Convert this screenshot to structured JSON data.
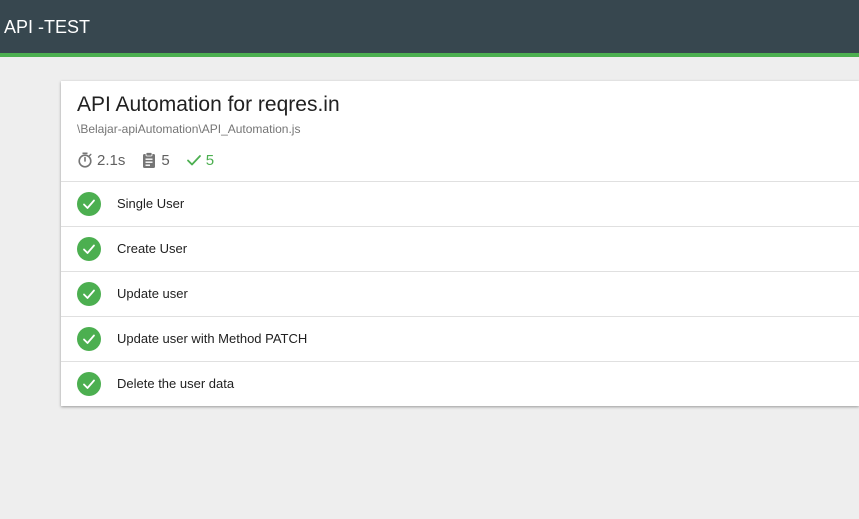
{
  "header": {
    "title": "API -TEST"
  },
  "suite": {
    "title": "API Automation for reqres.in",
    "file": "\\Belajar-apiAutomation\\API_Automation.js",
    "stats": {
      "duration": "2.1s",
      "tests": "5",
      "passed": "5"
    }
  },
  "tests": [
    {
      "title": "Single User",
      "status": "passed"
    },
    {
      "title": "Create User",
      "status": "passed"
    },
    {
      "title": "Update user",
      "status": "passed"
    },
    {
      "title": "Update user with Method PATCH",
      "status": "passed"
    },
    {
      "title": "Delete the user data",
      "status": "passed"
    }
  ],
  "colors": {
    "topbar": "#37474f",
    "accent": "#4caf50",
    "background": "#eeeeee"
  },
  "icons": {
    "duration": "stopwatch-icon",
    "tests": "clipboard-icon",
    "passed": "check-icon",
    "test_status": "check-circle-icon"
  }
}
